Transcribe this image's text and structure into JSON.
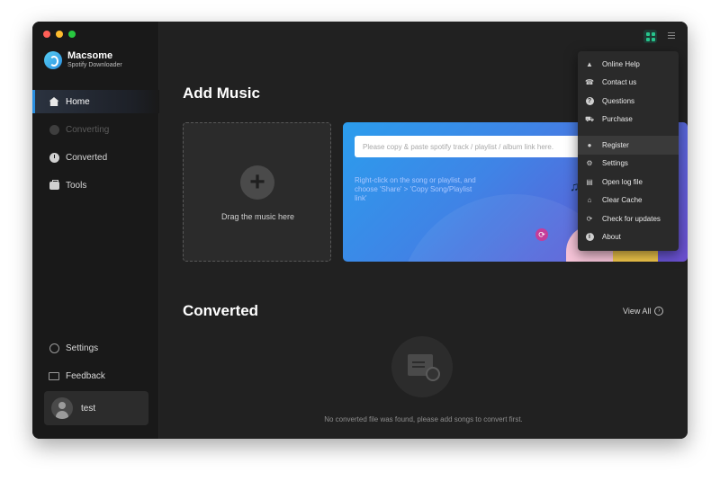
{
  "brand": {
    "name": "Macsome",
    "subtitle": "Spotify Downloader"
  },
  "sidebar": {
    "items": [
      {
        "label": "Home",
        "icon": "home-icon",
        "state": "active"
      },
      {
        "label": "Converting",
        "icon": "converting-icon",
        "state": "disabled"
      },
      {
        "label": "Converted",
        "icon": "clock-icon",
        "state": "normal"
      },
      {
        "label": "Tools",
        "icon": "toolbox-icon",
        "state": "normal"
      }
    ],
    "bottom_items": [
      {
        "label": "Settings",
        "icon": "settings-icon"
      },
      {
        "label": "Feedback",
        "icon": "mail-icon"
      }
    ],
    "user": {
      "name": "test"
    }
  },
  "main": {
    "add_music_title": "Add Music",
    "drop_zone_label": "Drag the music here",
    "url_placeholder": "Please copy & paste spotify track / playlist / album link here.",
    "url_hint": "Right-click on the song or playlist, and choose 'Share' > 'Copy Song/Playlist link'",
    "converted_title": "Converted",
    "view_all_label": "View All",
    "empty_message": "No converted file was found, please add songs to convert first."
  },
  "dropdown": {
    "items": [
      {
        "label": "Online Help",
        "icon": "graduation-cap-icon",
        "glyph": "🎓"
      },
      {
        "label": "Contact us",
        "icon": "phone-icon",
        "glyph": "☎"
      },
      {
        "label": "Questions",
        "icon": "question-icon",
        "glyph": "?"
      },
      {
        "label": "Purchase",
        "icon": "cart-icon",
        "glyph": "🛒"
      },
      {
        "label": "Register",
        "icon": "user-key-icon",
        "glyph": "👤"
      },
      {
        "label": "Settings",
        "icon": "gear-icon",
        "glyph": "⚙"
      },
      {
        "label": "Open log file",
        "icon": "file-icon",
        "glyph": "📄"
      },
      {
        "label": "Clear Cache",
        "icon": "broom-icon",
        "glyph": "🧹"
      },
      {
        "label": "Check for updates",
        "icon": "refresh-icon",
        "glyph": "⟳"
      },
      {
        "label": "About",
        "icon": "info-icon",
        "glyph": "i"
      }
    ],
    "hovered_index": 4
  },
  "colors": {
    "accent": "#2a8fe0",
    "grid_icon": "#27c48c"
  }
}
